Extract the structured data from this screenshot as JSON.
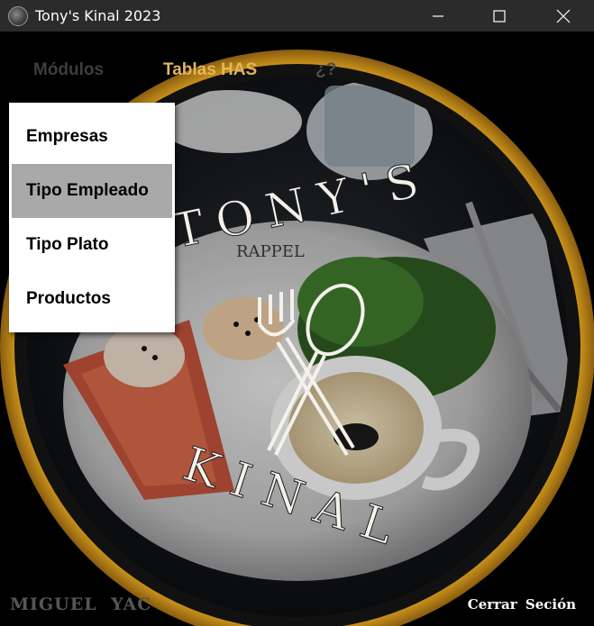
{
  "window": {
    "title": "Tony's Kinal 2023",
    "icon": "app-logo-icon",
    "controls": [
      "minimize-icon",
      "maximize-icon",
      "close-icon"
    ]
  },
  "menubar": {
    "items": [
      {
        "label": "Módulos",
        "state": "normal"
      },
      {
        "label": "Tablas HAS",
        "state": "open"
      },
      {
        "label": "¿?",
        "state": "normal"
      }
    ]
  },
  "dropdown": {
    "items": [
      {
        "label": "Empresas"
      },
      {
        "label": "Tipo Empleado",
        "state": "hover"
      },
      {
        "label": "Tipo Plato"
      },
      {
        "label": "Productos"
      }
    ]
  },
  "logo": {
    "top_text": "TONY'S",
    "bottom_text": "KINAL",
    "plate_text": "RAPPEL"
  },
  "footer": {
    "author": "MIGUEL  YAC",
    "logout_label": "Cerrar  Seción"
  },
  "colors": {
    "titlebar": "#2b2b2b",
    "ring_gold": "#d9a21a",
    "menu_active": "#e3b65a",
    "dropdown_hover": "#a9a9a9"
  }
}
